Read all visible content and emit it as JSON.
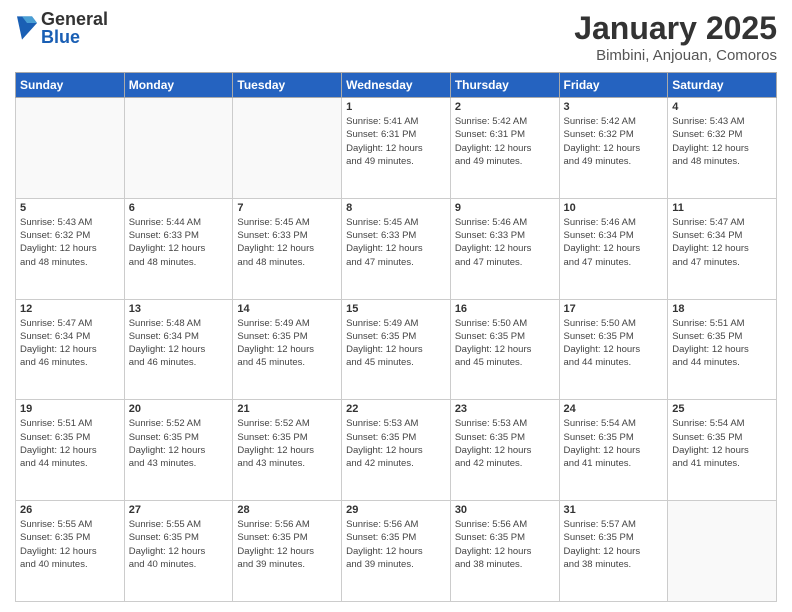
{
  "logo": {
    "general": "General",
    "blue": "Blue"
  },
  "header": {
    "month": "January 2025",
    "location": "Bimbini, Anjouan, Comoros"
  },
  "weekdays": [
    "Sunday",
    "Monday",
    "Tuesday",
    "Wednesday",
    "Thursday",
    "Friday",
    "Saturday"
  ],
  "weeks": [
    [
      {
        "day": "",
        "info": ""
      },
      {
        "day": "",
        "info": ""
      },
      {
        "day": "",
        "info": ""
      },
      {
        "day": "1",
        "info": "Sunrise: 5:41 AM\nSunset: 6:31 PM\nDaylight: 12 hours\nand 49 minutes."
      },
      {
        "day": "2",
        "info": "Sunrise: 5:42 AM\nSunset: 6:31 PM\nDaylight: 12 hours\nand 49 minutes."
      },
      {
        "day": "3",
        "info": "Sunrise: 5:42 AM\nSunset: 6:32 PM\nDaylight: 12 hours\nand 49 minutes."
      },
      {
        "day": "4",
        "info": "Sunrise: 5:43 AM\nSunset: 6:32 PM\nDaylight: 12 hours\nand 48 minutes."
      }
    ],
    [
      {
        "day": "5",
        "info": "Sunrise: 5:43 AM\nSunset: 6:32 PM\nDaylight: 12 hours\nand 48 minutes."
      },
      {
        "day": "6",
        "info": "Sunrise: 5:44 AM\nSunset: 6:33 PM\nDaylight: 12 hours\nand 48 minutes."
      },
      {
        "day": "7",
        "info": "Sunrise: 5:45 AM\nSunset: 6:33 PM\nDaylight: 12 hours\nand 48 minutes."
      },
      {
        "day": "8",
        "info": "Sunrise: 5:45 AM\nSunset: 6:33 PM\nDaylight: 12 hours\nand 47 minutes."
      },
      {
        "day": "9",
        "info": "Sunrise: 5:46 AM\nSunset: 6:33 PM\nDaylight: 12 hours\nand 47 minutes."
      },
      {
        "day": "10",
        "info": "Sunrise: 5:46 AM\nSunset: 6:34 PM\nDaylight: 12 hours\nand 47 minutes."
      },
      {
        "day": "11",
        "info": "Sunrise: 5:47 AM\nSunset: 6:34 PM\nDaylight: 12 hours\nand 47 minutes."
      }
    ],
    [
      {
        "day": "12",
        "info": "Sunrise: 5:47 AM\nSunset: 6:34 PM\nDaylight: 12 hours\nand 46 minutes."
      },
      {
        "day": "13",
        "info": "Sunrise: 5:48 AM\nSunset: 6:34 PM\nDaylight: 12 hours\nand 46 minutes."
      },
      {
        "day": "14",
        "info": "Sunrise: 5:49 AM\nSunset: 6:35 PM\nDaylight: 12 hours\nand 45 minutes."
      },
      {
        "day": "15",
        "info": "Sunrise: 5:49 AM\nSunset: 6:35 PM\nDaylight: 12 hours\nand 45 minutes."
      },
      {
        "day": "16",
        "info": "Sunrise: 5:50 AM\nSunset: 6:35 PM\nDaylight: 12 hours\nand 45 minutes."
      },
      {
        "day": "17",
        "info": "Sunrise: 5:50 AM\nSunset: 6:35 PM\nDaylight: 12 hours\nand 44 minutes."
      },
      {
        "day": "18",
        "info": "Sunrise: 5:51 AM\nSunset: 6:35 PM\nDaylight: 12 hours\nand 44 minutes."
      }
    ],
    [
      {
        "day": "19",
        "info": "Sunrise: 5:51 AM\nSunset: 6:35 PM\nDaylight: 12 hours\nand 44 minutes."
      },
      {
        "day": "20",
        "info": "Sunrise: 5:52 AM\nSunset: 6:35 PM\nDaylight: 12 hours\nand 43 minutes."
      },
      {
        "day": "21",
        "info": "Sunrise: 5:52 AM\nSunset: 6:35 PM\nDaylight: 12 hours\nand 43 minutes."
      },
      {
        "day": "22",
        "info": "Sunrise: 5:53 AM\nSunset: 6:35 PM\nDaylight: 12 hours\nand 42 minutes."
      },
      {
        "day": "23",
        "info": "Sunrise: 5:53 AM\nSunset: 6:35 PM\nDaylight: 12 hours\nand 42 minutes."
      },
      {
        "day": "24",
        "info": "Sunrise: 5:54 AM\nSunset: 6:35 PM\nDaylight: 12 hours\nand 41 minutes."
      },
      {
        "day": "25",
        "info": "Sunrise: 5:54 AM\nSunset: 6:35 PM\nDaylight: 12 hours\nand 41 minutes."
      }
    ],
    [
      {
        "day": "26",
        "info": "Sunrise: 5:55 AM\nSunset: 6:35 PM\nDaylight: 12 hours\nand 40 minutes."
      },
      {
        "day": "27",
        "info": "Sunrise: 5:55 AM\nSunset: 6:35 PM\nDaylight: 12 hours\nand 40 minutes."
      },
      {
        "day": "28",
        "info": "Sunrise: 5:56 AM\nSunset: 6:35 PM\nDaylight: 12 hours\nand 39 minutes."
      },
      {
        "day": "29",
        "info": "Sunrise: 5:56 AM\nSunset: 6:35 PM\nDaylight: 12 hours\nand 39 minutes."
      },
      {
        "day": "30",
        "info": "Sunrise: 5:56 AM\nSunset: 6:35 PM\nDaylight: 12 hours\nand 38 minutes."
      },
      {
        "day": "31",
        "info": "Sunrise: 5:57 AM\nSunset: 6:35 PM\nDaylight: 12 hours\nand 38 minutes."
      },
      {
        "day": "",
        "info": ""
      }
    ]
  ]
}
